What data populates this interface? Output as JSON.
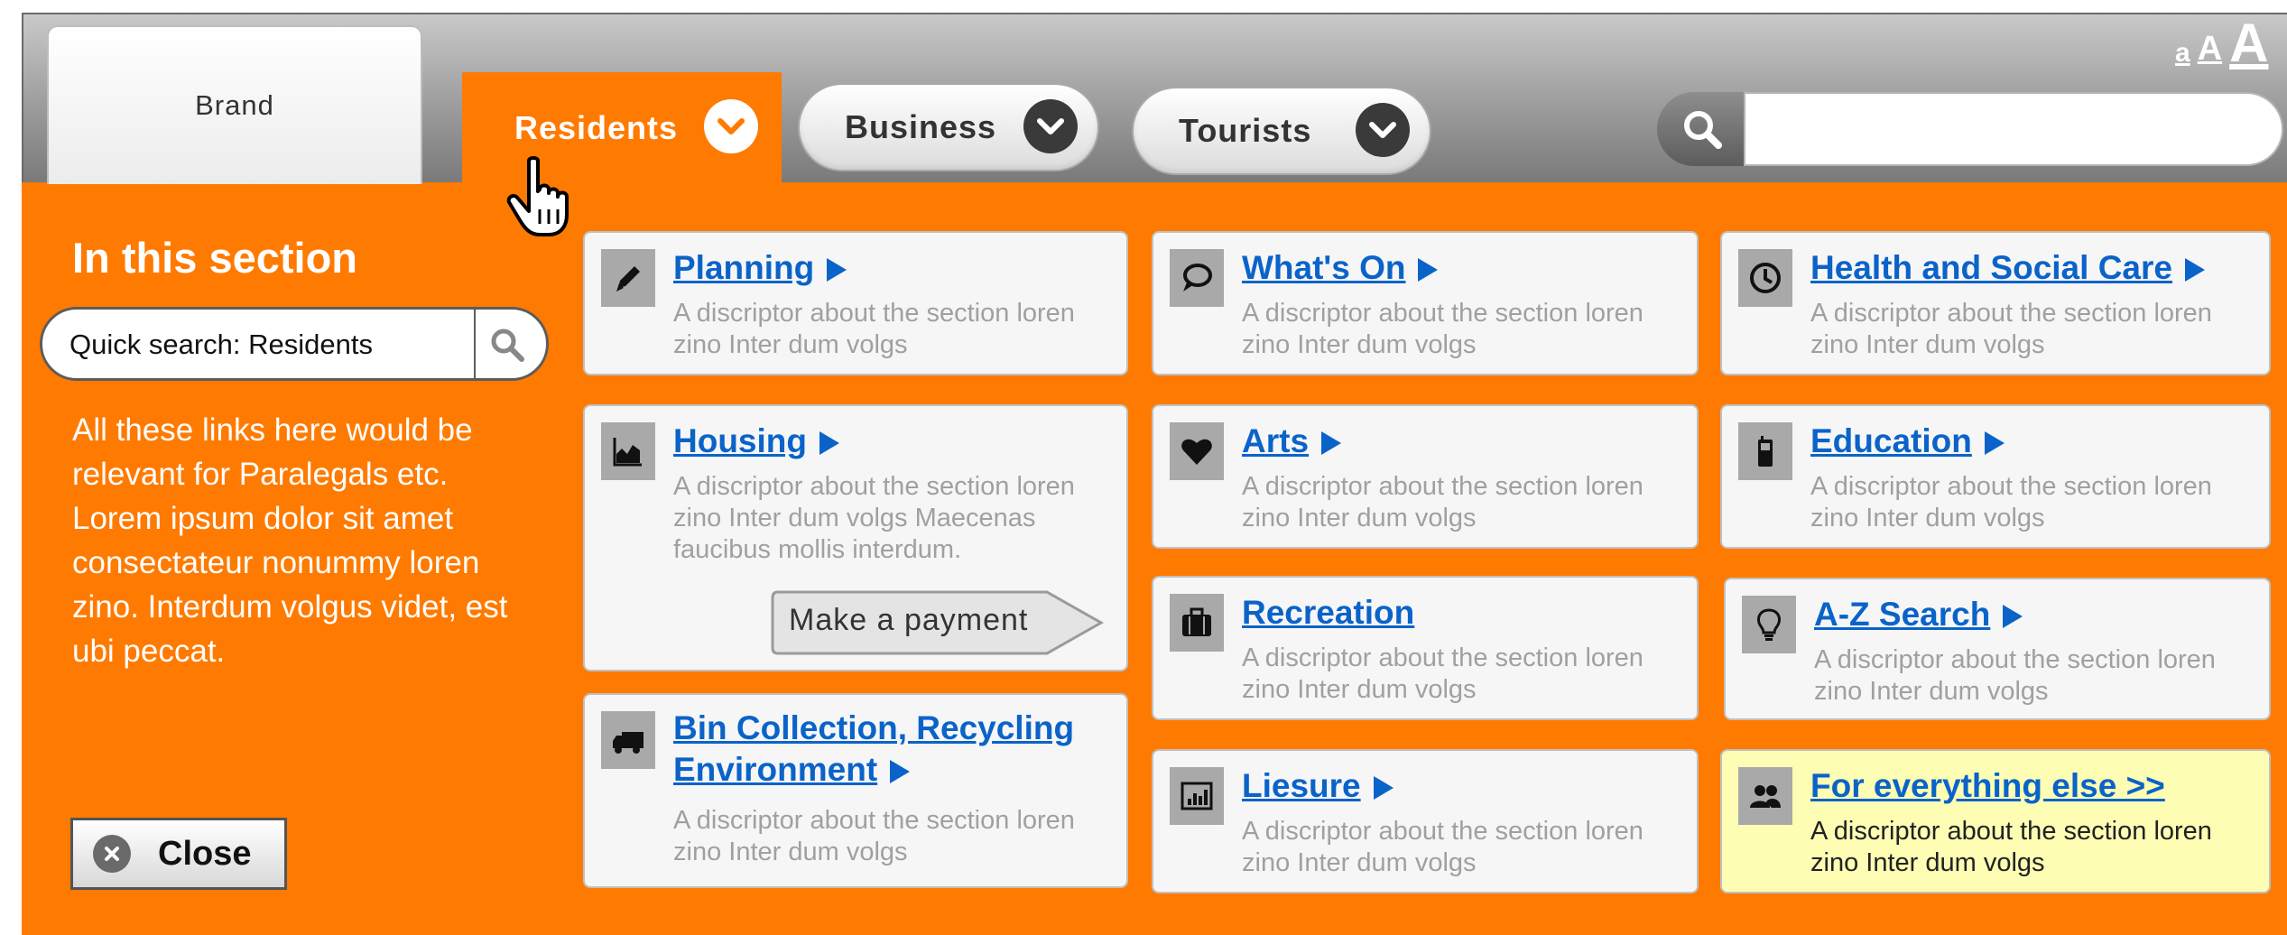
{
  "brand": {
    "label": "Brand"
  },
  "nav": {
    "tabs": [
      {
        "label": "Residents",
        "active": true
      },
      {
        "label": "Business",
        "active": false
      },
      {
        "label": "Tourists",
        "active": false
      }
    ]
  },
  "font_size": {
    "small": "a",
    "medium": "A",
    "large": "A"
  },
  "search": {
    "value": "",
    "placeholder": ""
  },
  "sidebar": {
    "title": "In this section",
    "quick_search": "Quick search: Residents",
    "text": "All these links here would be relevant for Paralegals etc. Lorem ipsum dolor sit amet consectateur nonummy loren zino. Interdum volgus videt, est ubi peccat.",
    "close_label": "Close"
  },
  "cards": {
    "planning": {
      "title": "Planning",
      "desc": "A discriptor about the section loren zino Inter dum volgs",
      "icon": "pencil-icon"
    },
    "housing": {
      "title": "Housing",
      "desc": "A discriptor about the section loren zino Inter dum volgs Maecenas faucibus mollis interdum.",
      "icon": "area-chart-icon",
      "action": "Make a payment"
    },
    "bin": {
      "title_line1": "Bin Collection, Recycling",
      "title_line2": "Environment",
      "desc": "A discriptor about the section loren zino Inter dum volgs",
      "icon": "truck-icon"
    },
    "whatson": {
      "title": "What's On",
      "desc": "A discriptor about the section loren zino Inter dum volgs",
      "icon": "speech-bubble-icon"
    },
    "arts": {
      "title": "Arts",
      "desc": "A discriptor about the section loren zino Inter dum volgs",
      "icon": "heart-icon"
    },
    "recreation": {
      "title": "Recreation",
      "desc": "A discriptor about the section loren zino Inter dum volgs",
      "icon": "briefcase-icon"
    },
    "liesure": {
      "title": "Liesure",
      "desc": "A discriptor about the section loren zino Inter dum volgs",
      "icon": "chart-board-icon"
    },
    "health": {
      "title": "Health and Social Care",
      "desc": "A discriptor about the section loren zino Inter dum volgs",
      "icon": "clock-icon"
    },
    "education": {
      "title": "Education",
      "desc": "A discriptor about the section loren zino Inter dum volgs",
      "icon": "mobile-phone-icon"
    },
    "azsearch": {
      "title": "A-Z Search",
      "desc": "A discriptor about the section loren zino Inter dum volgs",
      "icon": "lightbulb-icon"
    },
    "everything": {
      "title": "For everything else >>",
      "desc": "A discriptor about the section loren zino Inter dum volgs",
      "icon": "people-icon"
    }
  },
  "colors": {
    "accent": "#ff7a00",
    "link": "#0a63c9",
    "highlight": "#fdfdb4"
  }
}
